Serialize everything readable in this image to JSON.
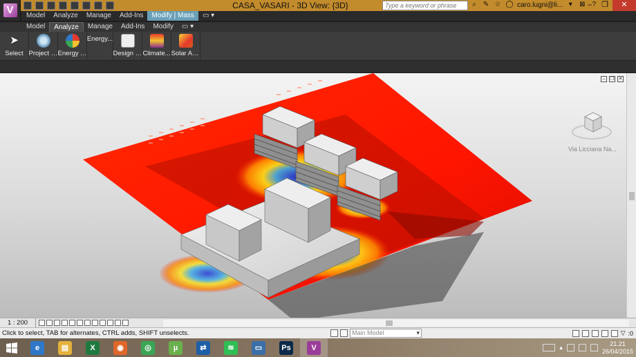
{
  "window": {
    "title": "CASA_VASARI - 3D View: {3D}",
    "search_placeholder": "Type a keyword or phrase",
    "user": "caro.lugni@li...",
    "help": "?"
  },
  "ribbon_tabs_top": [
    "Model",
    "Analyze",
    "Manage",
    "Add-Ins",
    "Modify | Mass"
  ],
  "ribbon_tabs": [
    "Model",
    "Analyze",
    "Manage",
    "Add-Ins",
    "Modify"
  ],
  "active_tab": "Analyze",
  "ribbon_buttons": [
    {
      "label": "Select",
      "icon": "cursor-icon"
    },
    {
      "label": "Project L...",
      "icon": "project-location-icon"
    },
    {
      "label": "Energy A...",
      "icon": "energy-analysis-icon"
    },
    {
      "label": "Energy...",
      "icon": "energy-settings-icon"
    },
    {
      "label": "Design O...",
      "icon": "design-options-icon"
    },
    {
      "label": "Climate...",
      "icon": "climate-icon"
    },
    {
      "label": "Solar An...",
      "icon": "solar-analysis-icon"
    }
  ],
  "viewport": {
    "viewcube_label": "Via Licciana Na..."
  },
  "view_control": {
    "scale": "1 : 200"
  },
  "status": {
    "text": "Click to select, TAB for alternates, CTRL adds, SHIFT unselects.",
    "workset": "Main Model",
    "filter_count": ":0"
  },
  "taskbar": {
    "apps": [
      {
        "name": "internet-explorer",
        "color": "#2f78c8",
        "glyph": "e"
      },
      {
        "name": "file-explorer",
        "color": "#e4b13c",
        "glyph": "▤"
      },
      {
        "name": "excel",
        "color": "#1f7a3f",
        "glyph": "X"
      },
      {
        "name": "firefox",
        "color": "#e0672a",
        "glyph": "◉"
      },
      {
        "name": "chrome",
        "color": "#3aa655",
        "glyph": "◎"
      },
      {
        "name": "utorrent",
        "color": "#6ab04c",
        "glyph": "µ"
      },
      {
        "name": "teamviewer",
        "color": "#1e5fa6",
        "glyph": "⇄"
      },
      {
        "name": "spotify",
        "color": "#2fbf54",
        "glyph": "≋"
      },
      {
        "name": "remote-desktop",
        "color": "#3b6fa8",
        "glyph": "▭"
      },
      {
        "name": "photoshop",
        "color": "#0b2a4a",
        "glyph": "Ps"
      },
      {
        "name": "vasari",
        "color": "#9a3d9a",
        "glyph": "V"
      }
    ],
    "time": "21.21",
    "date": "26/04/2015"
  },
  "colors": {
    "title_bar": "#c28b2c",
    "context_tab": "#6aa0b8",
    "analysis_hot": "#ff1a00",
    "analysis_mid": "#ffd21a",
    "analysis_cold": "#1a2fd6"
  }
}
